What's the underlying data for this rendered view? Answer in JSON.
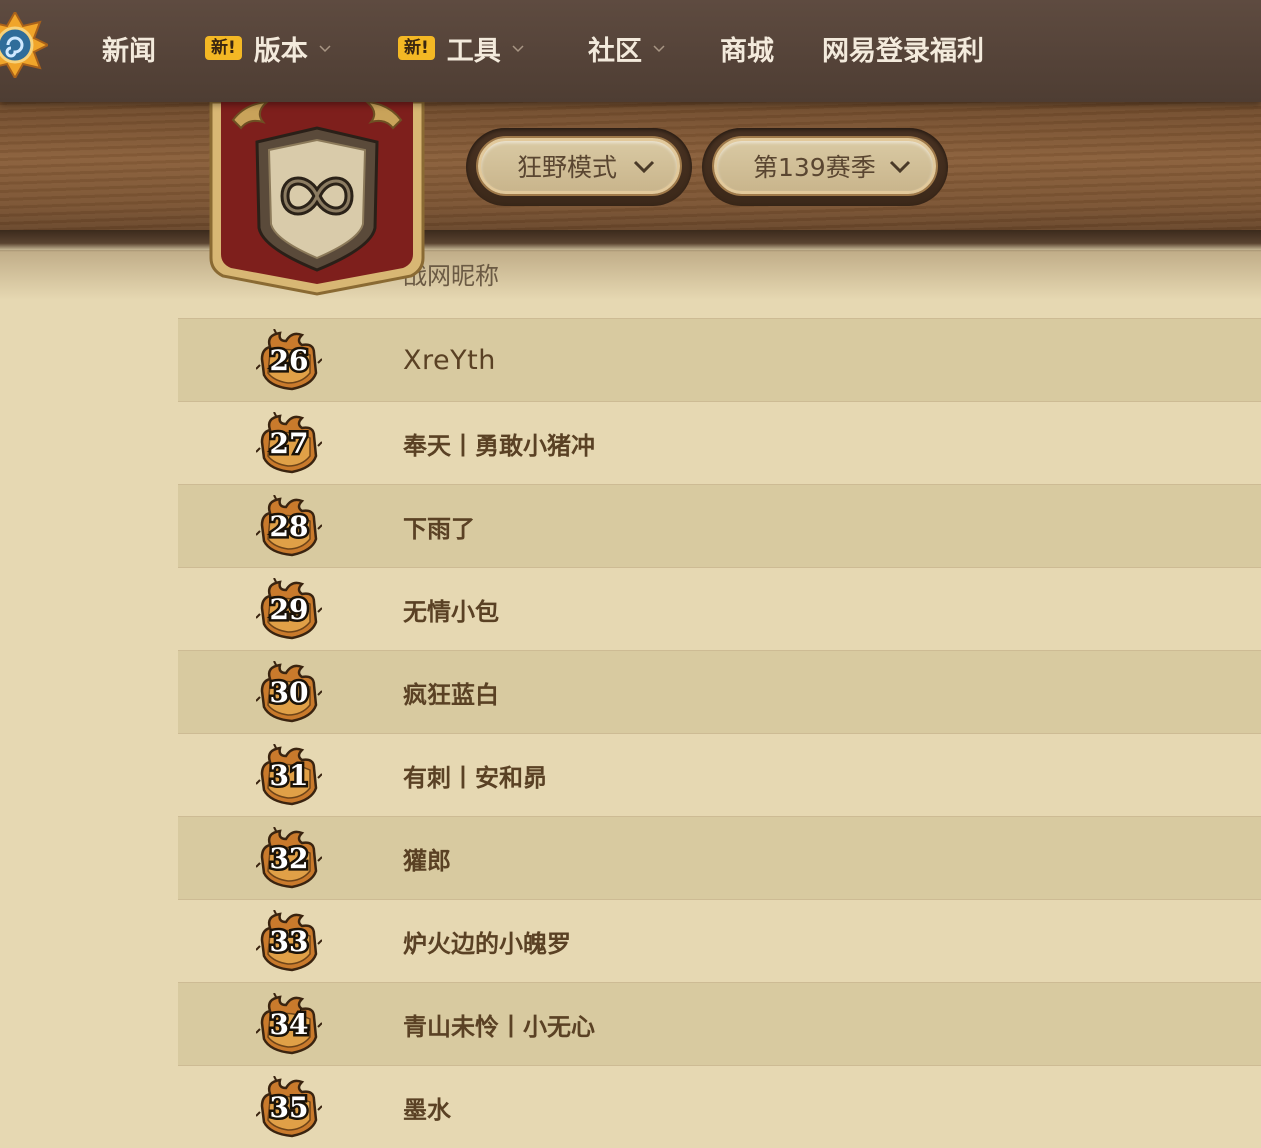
{
  "nav": {
    "items": [
      {
        "label": "新闻",
        "badge": "",
        "dropdown": false
      },
      {
        "label": "版本",
        "badge": "新!",
        "dropdown": true
      },
      {
        "label": "工具",
        "badge": "新!",
        "dropdown": true
      },
      {
        "label": "社区",
        "badge": "",
        "dropdown": true
      },
      {
        "label": "商城",
        "badge": "",
        "dropdown": false
      },
      {
        "label": "网易登录福利",
        "badge": "",
        "dropdown": false
      }
    ]
  },
  "filters": {
    "mode": "狂野模式",
    "season": "第139赛季"
  },
  "table": {
    "name_header": "战网昵称",
    "rows": [
      {
        "rank": "26",
        "name": "XreYth"
      },
      {
        "rank": "27",
        "name": "奉天丨勇敢小猪冲"
      },
      {
        "rank": "28",
        "name": "下雨了"
      },
      {
        "rank": "29",
        "name": "无情小包"
      },
      {
        "rank": "30",
        "name": "疯狂蓝白"
      },
      {
        "rank": "31",
        "name": "有刺丨安和昴"
      },
      {
        "rank": "32",
        "name": "獾郎"
      },
      {
        "rank": "33",
        "name": "炉火边的小魄罗"
      },
      {
        "rank": "34",
        "name": "青山未怜丨小无心"
      },
      {
        "rank": "35",
        "name": "墨水"
      }
    ]
  },
  "colors": {
    "nav_bg": "#5e4b40",
    "badge": "#f4b824",
    "row_alt": "#d8caa0",
    "page_bg": "#e6d8b2",
    "name_text": "#5a4124"
  },
  "icons": {
    "logo": "hearthstone-logo-icon",
    "emblem": "wild-mode-infinity-icon",
    "rank_badge": "rank-badge-icon",
    "dropdown": "chevron-down-icon"
  }
}
